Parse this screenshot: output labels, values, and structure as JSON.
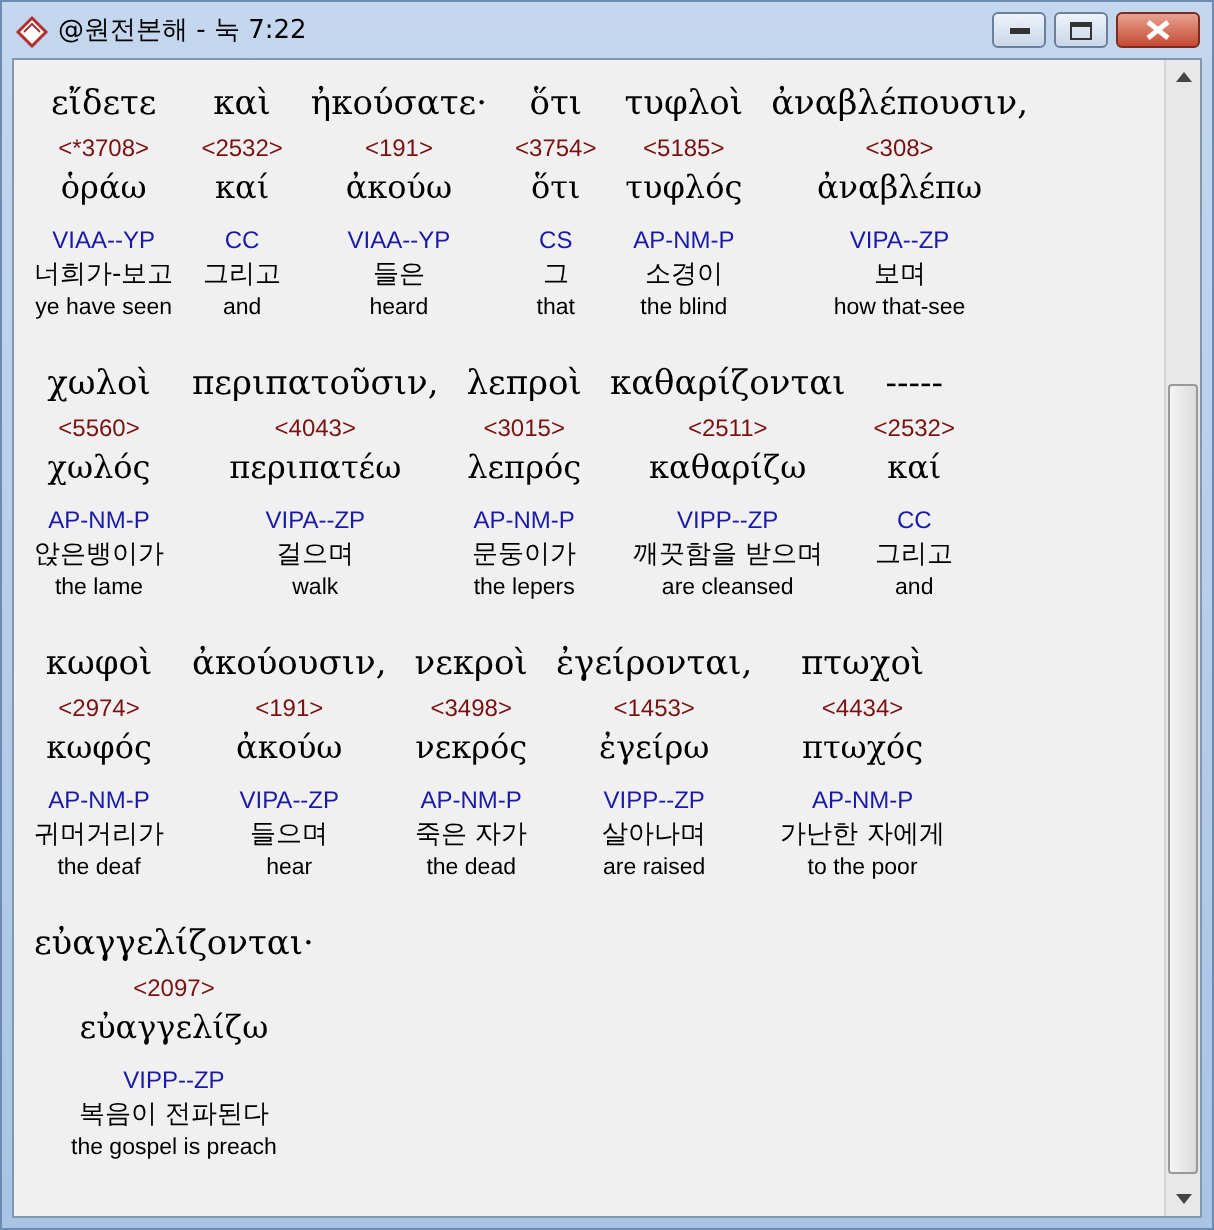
{
  "window": {
    "title": "@원전본해 - 눅 7:22"
  },
  "lines": [
    {
      "words": [
        {
          "greek": "εἴδετε",
          "strong": "<*3708>",
          "lemma": "ὁράω",
          "parse": "VIAA--YP",
          "korean": "너희가-보고",
          "english": "ye have seen"
        },
        {
          "greek": "καὶ",
          "strong": "<2532>",
          "lemma": "καί",
          "parse": "CC",
          "korean": "그리고",
          "english": "and"
        },
        {
          "greek": "ἠκούσατε·",
          "strong": "<191>",
          "lemma": "ἀκούω",
          "parse": "VIAA--YP",
          "korean": "들은",
          "english": "heard"
        },
        {
          "greek": "ὅτι",
          "strong": "<3754>",
          "lemma": "ὅτι",
          "parse": "CS",
          "korean": "그",
          "english": "that"
        },
        {
          "greek": "τυφλοὶ",
          "strong": "<5185>",
          "lemma": "τυφλός",
          "parse": "AP-NM-P",
          "korean": "소경이",
          "english": "the blind"
        },
        {
          "greek": "ἀναβλέπουσιν,",
          "strong": "<308>",
          "lemma": "ἀναβλέπω",
          "parse": "VIPA--ZP",
          "korean": "보며",
          "english": "how that-see"
        }
      ]
    },
    {
      "words": [
        {
          "greek": "χωλοὶ",
          "strong": "<5560>",
          "lemma": "χωλός",
          "parse": "AP-NM-P",
          "korean": "앉은뱅이가",
          "english": "the lame"
        },
        {
          "greek": "περιπατοῦσιν,",
          "strong": "<4043>",
          "lemma": "περιπατέω",
          "parse": "VIPA--ZP",
          "korean": "걸으며",
          "english": "walk"
        },
        {
          "greek": "λεπροὶ",
          "strong": "<3015>",
          "lemma": "λεπρός",
          "parse": "AP-NM-P",
          "korean": "문둥이가",
          "english": "the lepers"
        },
        {
          "greek": "καθαρίζονται",
          "strong": "<2511>",
          "lemma": "καθαρίζω",
          "parse": "VIPP--ZP",
          "korean": "깨끗함을 받으며",
          "english": "are cleansed"
        },
        {
          "greek": "-----",
          "strong": "<2532>",
          "lemma": "καί",
          "parse": "CC",
          "korean": "그리고",
          "english": "and"
        }
      ]
    },
    {
      "words": [
        {
          "greek": "κωφοὶ",
          "strong": "<2974>",
          "lemma": "κωφός",
          "parse": "AP-NM-P",
          "korean": "귀머거리가",
          "english": "the deaf"
        },
        {
          "greek": "ἀκούουσιν,",
          "strong": "<191>",
          "lemma": "ἀκούω",
          "parse": "VIPA--ZP",
          "korean": "들으며",
          "english": "hear"
        },
        {
          "greek": "νεκροὶ",
          "strong": "<3498>",
          "lemma": "νεκρός",
          "parse": "AP-NM-P",
          "korean": "죽은 자가",
          "english": "the dead"
        },
        {
          "greek": "ἐγείρονται,",
          "strong": "<1453>",
          "lemma": "ἐγείρω",
          "parse": "VIPP--ZP",
          "korean": "살아나며",
          "english": "are raised"
        },
        {
          "greek": "πτωχοὶ",
          "strong": "<4434>",
          "lemma": "πτωχός",
          "parse": "AP-NM-P",
          "korean": "가난한 자에게",
          "english": "to the poor"
        }
      ]
    },
    {
      "words": [
        {
          "greek": "εὐαγγελίζονται·",
          "strong": "<2097>",
          "lemma": "εὐαγγελίζω",
          "parse": "VIPP--ZP",
          "korean": "복음이 전파된다",
          "english": "the gospel is preach"
        }
      ]
    }
  ]
}
